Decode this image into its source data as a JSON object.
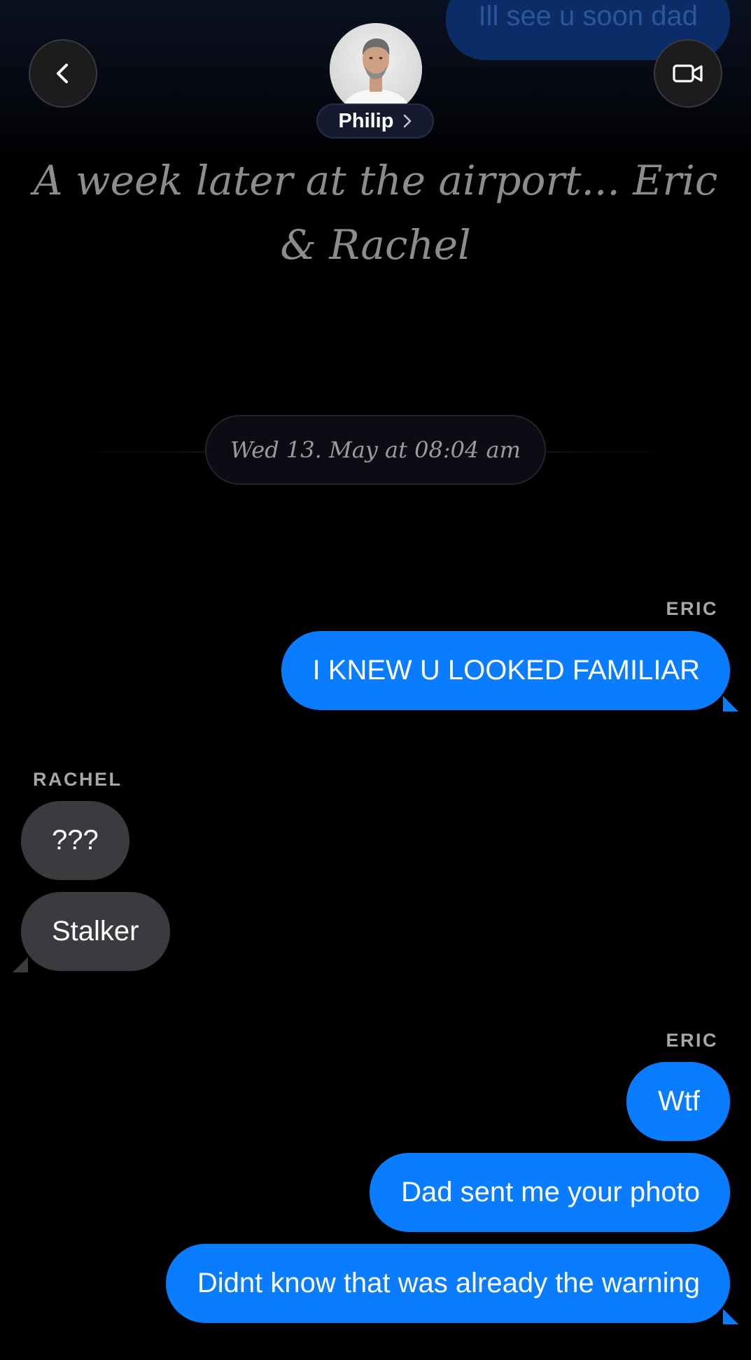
{
  "header": {
    "contact_name": "Philip",
    "back_icon": "chevron-left-icon",
    "video_icon": "video-camera-icon",
    "avatar_label": "Philip avatar"
  },
  "previous_message": {
    "text": "Ill see u soon dad"
  },
  "scene_title": "A week later at the airport... Eric & Rachel",
  "timestamp": "Wed 13. May at 08:04 am",
  "conversation": {
    "group1": {
      "sender": "ERIC",
      "messages": [
        "I KNEW U LOOKED FAMILIAR"
      ]
    },
    "group2": {
      "sender": "RACHEL",
      "messages": [
        "???",
        "Stalker"
      ]
    },
    "group3": {
      "sender": "ERIC",
      "messages": [
        "Wtf",
        "Dad sent me your photo",
        "Didnt know that was already the warning"
      ]
    }
  },
  "colors": {
    "outgoing_bubble": "#0a7cff",
    "incoming_bubble": "#3b3b3f",
    "background": "#000000"
  }
}
